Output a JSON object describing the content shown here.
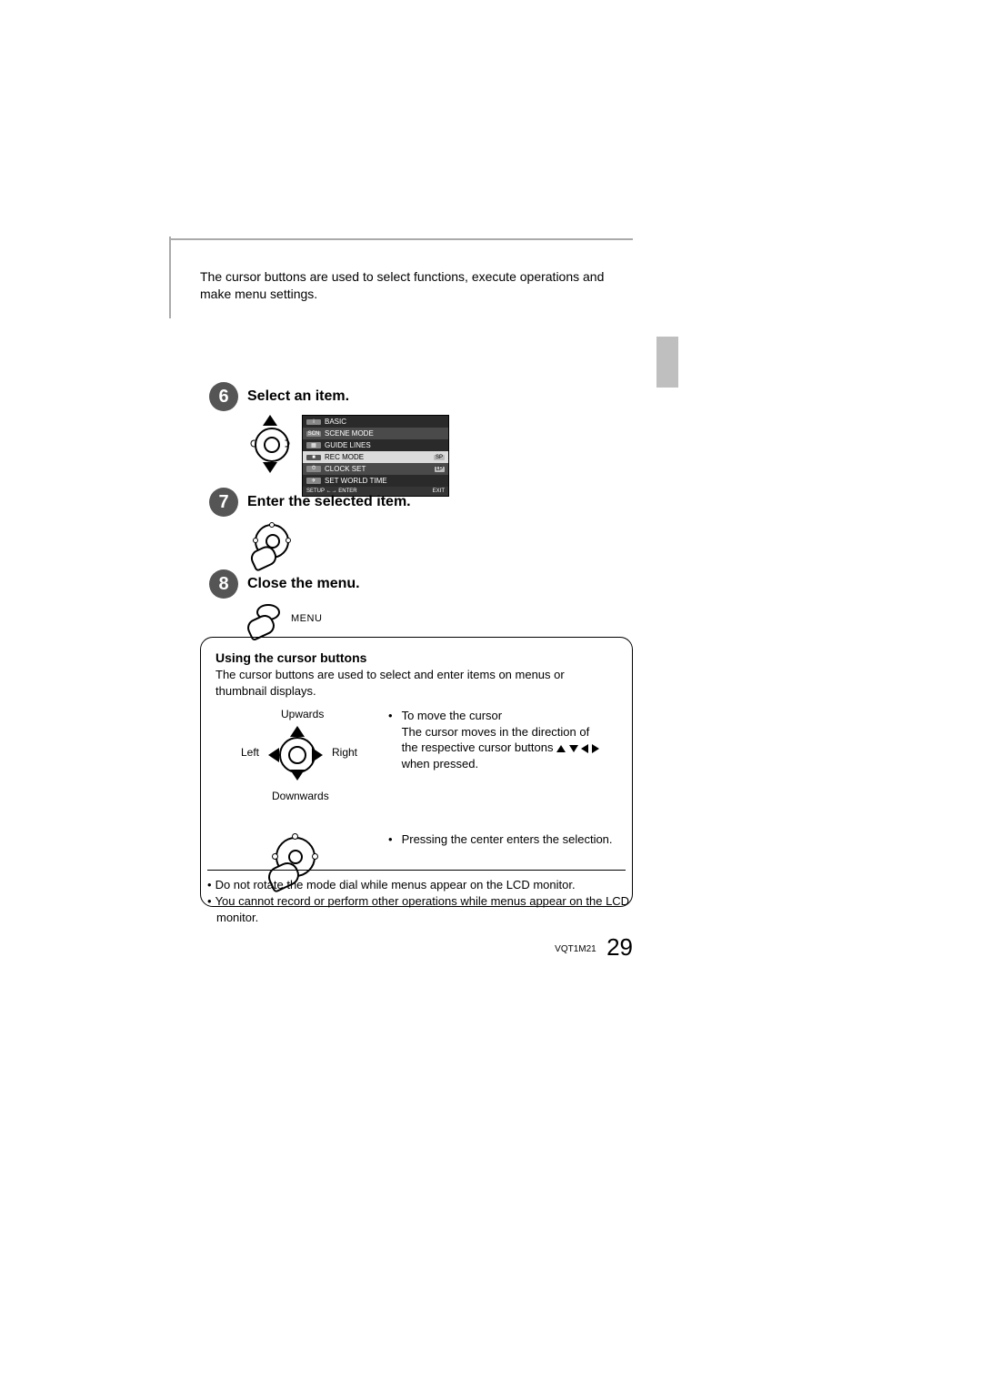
{
  "intro": "The cursor buttons are used to select functions, execute operations and make menu settings.",
  "steps": {
    "s6": {
      "num": "6",
      "title": "Select an item."
    },
    "s7": {
      "num": "7",
      "title": "Enter the selected item."
    },
    "s8": {
      "num": "8",
      "title": "Close the menu.",
      "menu_label": "MENU"
    }
  },
  "osd": {
    "r1": "BASIC",
    "r2": "SCENE MODE",
    "r3": "GUIDE LINES",
    "r4": "REC MODE",
    "r4v": "SP",
    "r5": "CLOCK SET",
    "r5v": "LP",
    "r6": "SET WORLD TIME",
    "foot_left": "SETUP ←→ ENTER",
    "foot_right": "EXIT"
  },
  "box": {
    "heading": "Using the cursor buttons",
    "lead": "The cursor buttons are used to select and enter items on menus or thumbnail displays.",
    "labels": {
      "up": "Upwards",
      "down": "Downwards",
      "left": "Left",
      "right": "Right"
    },
    "b1_head": "To move the cursor",
    "b1_line1": "The cursor moves in the direction of",
    "b1_line2a": "the respective cursor buttons ",
    "b1_line3": "when pressed.",
    "b2": "Pressing the center enters the selection."
  },
  "notes": {
    "n1": "Do not rotate the mode dial while menus appear on the LCD monitor.",
    "n2": "You cannot record or perform other operations while menus appear on the LCD monitor."
  },
  "footer": {
    "code": "VQT1M21",
    "page": "29"
  }
}
